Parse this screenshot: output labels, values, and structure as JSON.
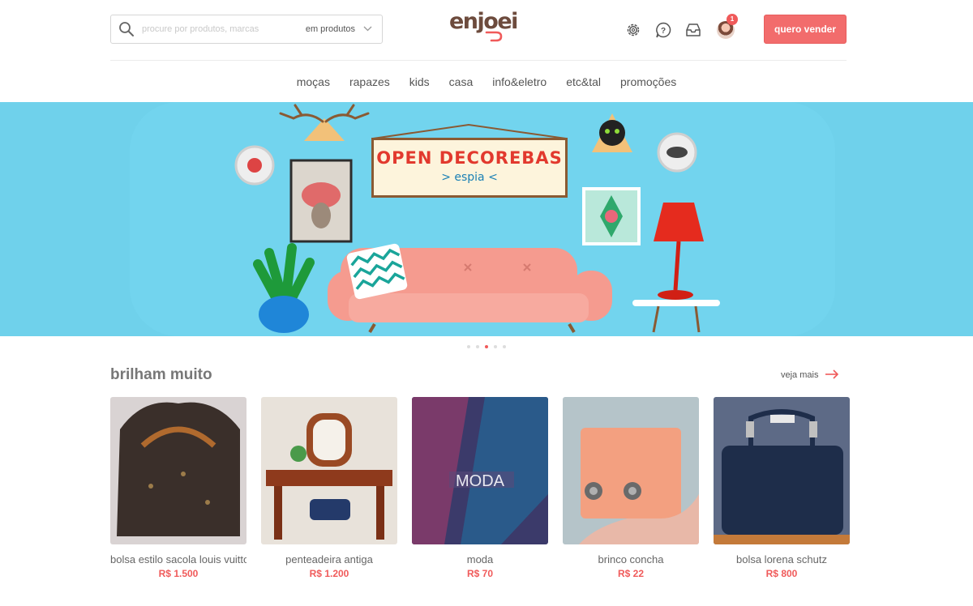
{
  "header": {
    "search_placeholder": "procure por produtos, marcas",
    "search_scope": "em produtos",
    "logo": "enjoei",
    "notification_count": "1",
    "sell_label": "quero vender"
  },
  "nav": {
    "items": [
      "moças",
      "rapazes",
      "kids",
      "casa",
      "info&eletro",
      "etc&tal",
      "promoções"
    ]
  },
  "banner": {
    "title": "OPEN DECOREBAS",
    "subtitle": "> espia <",
    "active_slide": 3,
    "slide_count": 5
  },
  "section": {
    "title": "brilham muito",
    "see_more": "veja mais"
  },
  "products": [
    {
      "name": "bolsa estilo sacola louis vuitton",
      "price": "R$ 1.500"
    },
    {
      "name": "penteadeira antiga",
      "price": "R$ 1.200"
    },
    {
      "name": "moda",
      "price": "R$ 70"
    },
    {
      "name": "brinco concha",
      "price": "R$ 22"
    },
    {
      "name": "bolsa lorena schutz",
      "price": "R$ 800"
    }
  ],
  "colors": {
    "accent": "#f26c6c",
    "price": "#f05a5a",
    "banner_bg": "#6fd1eb",
    "logo": "#6d4b3d"
  },
  "icons": [
    "search-icon",
    "chevron-down-icon",
    "gear-icon",
    "help-icon",
    "inbox-icon",
    "avatar",
    "arrow-right-icon"
  ]
}
